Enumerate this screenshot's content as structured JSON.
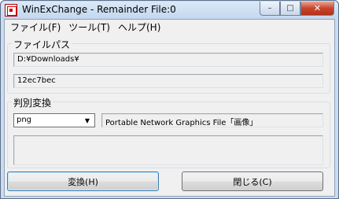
{
  "window": {
    "title": "WinExChange - Remainder File:0",
    "minimize_glyph": "–",
    "maximize_glyph": "□",
    "close_glyph": "✕"
  },
  "menu": [
    "ファイル(F)",
    "ツール(T)",
    "ヘルプ(H)"
  ],
  "file_path": {
    "label": "ファイルパス",
    "folder": "D:¥Downloads¥",
    "file": "12ec7bec"
  },
  "identify": {
    "label": "判別変換",
    "type_selected": "png",
    "type_description": "Portable Network Graphics File「画像」",
    "message": ""
  },
  "buttons": {
    "convert": "変換(H)",
    "close": "閉じる(C)"
  },
  "icons": {
    "app": "app-icon",
    "dropdown": "chevron-down-icon"
  }
}
